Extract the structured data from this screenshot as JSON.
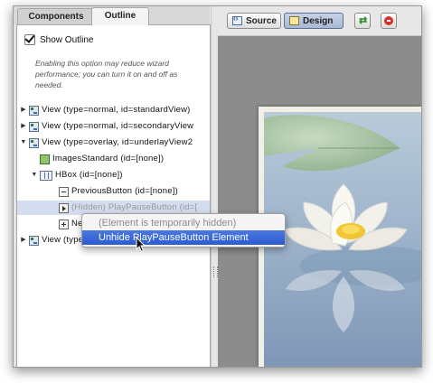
{
  "tabs": {
    "components": "Components",
    "outline": "Outline"
  },
  "show_outline": {
    "label": "Show Outline",
    "checked": true
  },
  "hint": "Enabling this option may reduce wizard performance; you can turn it on and off as needed.",
  "tree": [
    {
      "label": "View (type=normal, id=standardView)",
      "icon": "view-icon",
      "expanded": false
    },
    {
      "label": "View (type=normal, id=secondaryView",
      "icon": "view-icon",
      "expanded": false
    },
    {
      "label": "View (type=overlay, id=underlayView2",
      "icon": "view-icon",
      "expanded": true
    },
    {
      "label": "ImagesStandard (id=[none])",
      "icon": "image-icon"
    },
    {
      "label": "HBox (id=[none])",
      "icon": "hbox-icon",
      "expanded": true
    },
    {
      "label": "PreviousButton (id=[none])",
      "icon": "previous-button-icon"
    },
    {
      "label": "(Hidden) PlayPauseButton (id=[",
      "icon": "play-button-icon",
      "selected": true
    },
    {
      "label": "Ne",
      "icon": "next-button-icon"
    },
    {
      "label": "View (type=overlay, id=overlayView",
      "icon": "view-icon",
      "expanded": false
    }
  ],
  "toolbar": {
    "source": "Source",
    "design": "Design",
    "refresh_icon": "refresh-icon",
    "stop_icon": "stop-icon"
  },
  "menu": {
    "disabled_item": "(Element is temporarily hidden)",
    "active_item": "Unhide PlayPauseButton Element"
  },
  "colors": {
    "selection": "#2c5bd0",
    "canvas": "#8c8c8c",
    "tree_selected": "#d4dcef"
  }
}
